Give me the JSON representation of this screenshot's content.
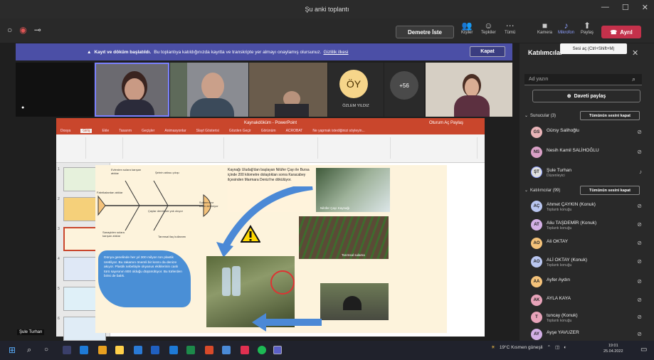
{
  "window": {
    "title": "Şu anki toplantı",
    "controls": [
      "—",
      "☐",
      "✕"
    ]
  },
  "toolbar": {
    "left_icons": [
      "○",
      "◉",
      "⊸"
    ],
    "share_label": "Demetre İste",
    "buttons": [
      {
        "label": "Kişiler",
        "icon": "people-icon"
      },
      {
        "label": "Tepkiler",
        "icon": "reaction-icon"
      },
      {
        "label": "Tümü",
        "icon": "more-icon"
      },
      {
        "label": "Kamera",
        "icon": "camera-icon"
      },
      {
        "label": "Mikrofon",
        "icon": "mic-icon"
      },
      {
        "label": "Paylaş",
        "icon": "share-icon"
      }
    ],
    "leave_label": "Ayrıl"
  },
  "banner": {
    "bold": "Kayıt ve döküm başlatıldı.",
    "text": "Bu toplantıya katıldığınızda kayıtta ve transkripte yer almayı onaylamış olursunuz.",
    "link": "Gizlilik ilkesi",
    "close_label": "Kapat"
  },
  "video_strip": {
    "initials_tile": {
      "initials": "ÖY",
      "name": "ÖZLEM YILDIZ"
    },
    "more_count": "+56"
  },
  "presenter_name": "Şule Turhan",
  "ppt": {
    "title": "Kaynakdöküm - PowerPoint",
    "tabs": [
      "Dosya",
      "Giriş",
      "Ekle",
      "Tasarım",
      "Geçişler",
      "Animasyonlar",
      "Slayt Gösterisi",
      "Gözden Geçir",
      "Görünüm",
      "ACROBAT",
      "Ne yapmak istediğinizi söyleyin..."
    ],
    "user": "Oturum Aç  Paylaş",
    "slide_numbers": [
      "1",
      "2",
      "3",
      "4",
      "5",
      "6"
    ],
    "slide": {
      "fishbone_labels": [
        "Evlerden sulara karışan atıklar",
        "Şehrin atıksu çıkışı",
        "Fabrikalardan atıklar",
        "Sulanmıyor kısım kirleniyor",
        "Tarımsal ilaç kullanımı",
        "Sanayiden sulara karışan atıklar",
        "Plastik atıkların atılması",
        "Çaylar derelerde yok oluyor"
      ],
      "river_text": "Kaynağı Uludağ'dan başlayan Nilüfer Çayı ile Bursa içinde 200 kilometre dolaştıktan sonra Karacabey ilçesinden Marmara Denizi'ne dökülüyor.",
      "river_caption": "Nilüfer Çayı Kaynağı",
      "plastic_text": "Dünya genelinde her yıl 300 milyon ton plastik üretiliyor. Bu rakamın önemli bir kısmı da denize akıyor. Plastik sebebiyle okyanus ekiklerinin canlı türü sayısının 800 olduğu düşünülüyor. Bu türlerden birisi de balık.",
      "field_caption": "Tarımsal sulama"
    }
  },
  "sidebar": {
    "title": "Katılımcılar",
    "tooltip": "Sesi aç (Ctrl+Shift+M)",
    "search_placeholder": "Ad yazın",
    "invite_label": "Daveti paylaş",
    "presenters_header": "Sunucular (3)",
    "presenters_btn": "Tümünün sesini kapat",
    "presenters": [
      {
        "initials": "GS",
        "name": "Gürsy Salihoğlu",
        "sub": "",
        "color": "#e8b4b8"
      },
      {
        "initials": "NS",
        "name": "Nesih Kamil SALİHOĞLU",
        "sub": "",
        "color": "#d9a0c6"
      },
      {
        "initials": "ŞT",
        "name": "Şule Turhan",
        "sub": "Düzenleyici",
        "color": "#e0e0e0"
      }
    ],
    "attendees_header": "Katılımcılar (99)",
    "attendees_btn": "Tümünün sesini kapat",
    "attendees": [
      {
        "initials": "AÇ",
        "name": "Ahmet ÇAYKIN (Konuk)",
        "sub": "Toplantı konuğu",
        "color": "#b9c6f0"
      },
      {
        "initials": "AT",
        "name": "Aliu TAŞDEMİR (Konuk)",
        "sub": "Toplantı konuğu",
        "color": "#d4b0e6"
      },
      {
        "initials": "AO",
        "name": "Ali OKTAY",
        "sub": "",
        "color": "#f4c27a"
      },
      {
        "initials": "AO",
        "name": "ALİ OKTAY (Konuk)",
        "sub": "Toplantı konuğu",
        "color": "#b9c6f0"
      },
      {
        "initials": "AA",
        "name": "Ayfer Aydın",
        "sub": "",
        "color": "#f4c27a"
      },
      {
        "initials": "AK",
        "name": "AYLA KAYA",
        "sub": "",
        "color": "#e7a3b9"
      },
      {
        "initials": "T",
        "name": "tuncay (Konuk)",
        "sub": "Toplantı konuğu",
        "color": "#e7a3b9"
      },
      {
        "initials": "AY",
        "name": "Ayşe YAVUZER",
        "sub": "",
        "color": "#d4b0e6"
      }
    ]
  },
  "taskbar": {
    "weather": "19°C  Kısmen güneşli",
    "time": "19:01",
    "date": "25.04.2022"
  }
}
